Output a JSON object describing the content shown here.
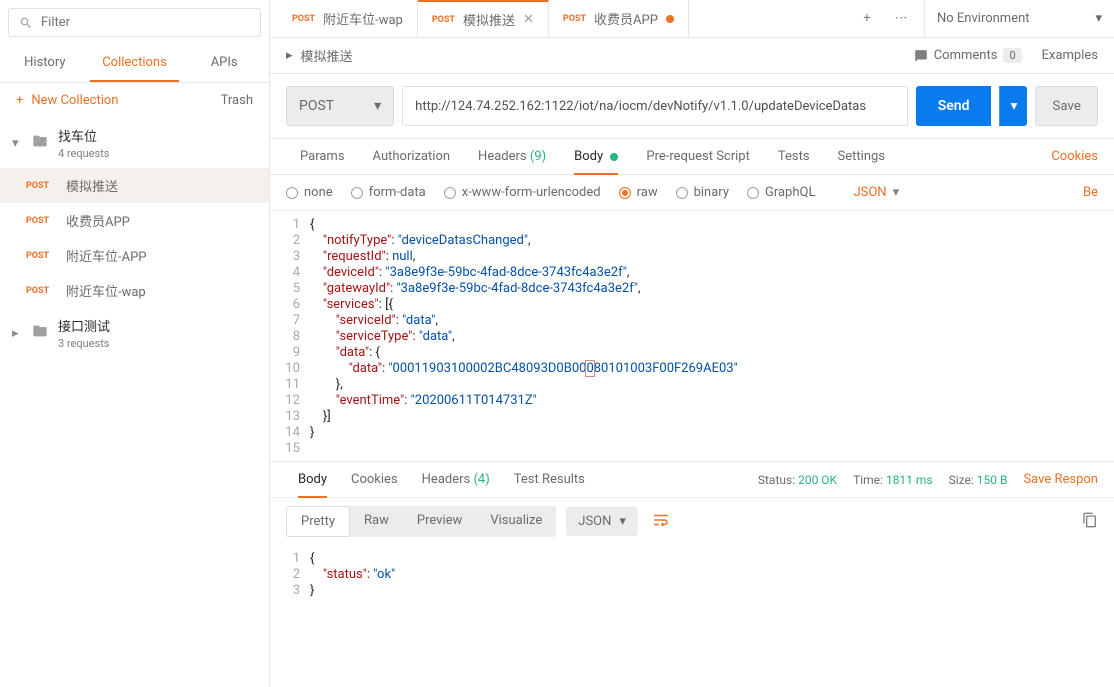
{
  "sidebar": {
    "filter_placeholder": "Filter",
    "tabs": {
      "history": "History",
      "collections": "Collections",
      "apis": "APIs"
    },
    "new_collection": "New Collection",
    "trash": "Trash",
    "folders": [
      {
        "name": "找车位",
        "sub": "4 requests",
        "expanded": true,
        "items": [
          {
            "method": "POST",
            "label": "模拟推送",
            "selected": true
          },
          {
            "method": "POST",
            "label": "收费员APP"
          },
          {
            "method": "POST",
            "label": "附近车位-APP"
          },
          {
            "method": "POST",
            "label": "附近车位-wap"
          }
        ]
      },
      {
        "name": "接口测试",
        "sub": "3 requests",
        "expanded": false
      }
    ]
  },
  "tabs": [
    {
      "method": "POST",
      "label": "附近车位-wap"
    },
    {
      "method": "POST",
      "label": "模拟推送",
      "active": true,
      "closable": true
    },
    {
      "method": "POST",
      "label": "收费员APP",
      "unsaved": true
    }
  ],
  "env": {
    "label": "No Environment"
  },
  "breadcrumb": {
    "title": "模拟推送"
  },
  "comments": {
    "label": "Comments",
    "count": "0"
  },
  "examples": "Examples",
  "request": {
    "method": "POST",
    "url": "http://124.74.252.162:1122/iot/na/iocm/devNotify/v1.1.0/updateDeviceDatas",
    "send": "Send",
    "save": "Save"
  },
  "req_tabs": {
    "params": "Params",
    "authorization": "Authorization",
    "headers": "Headers",
    "headers_count": "(9)",
    "body": "Body",
    "prerequest": "Pre-request Script",
    "tests": "Tests",
    "settings": "Settings",
    "cookies": "Cookies"
  },
  "body_types": {
    "none": "none",
    "form": "form-data",
    "url": "x-www-form-urlencoded",
    "raw": "raw",
    "binary": "binary",
    "graphql": "GraphQL",
    "lang": "JSON",
    "beautify": "Be"
  },
  "body_code": [
    {
      "n": "1",
      "indent": 0,
      "segs": [
        {
          "c": "tok-p",
          "t": "{"
        }
      ]
    },
    {
      "n": "2",
      "indent": 1,
      "segs": [
        {
          "c": "tok-k",
          "t": "\"notifyType\""
        },
        {
          "c": "tok-p",
          "t": ": "
        },
        {
          "c": "tok-s",
          "t": "\"deviceDatasChanged\""
        },
        {
          "c": "tok-p",
          "t": ","
        }
      ]
    },
    {
      "n": "3",
      "indent": 1,
      "segs": [
        {
          "c": "tok-k",
          "t": "\"requestId\""
        },
        {
          "c": "tok-p",
          "t": ": "
        },
        {
          "c": "tok-kw",
          "t": "null"
        },
        {
          "c": "tok-p",
          "t": ","
        }
      ]
    },
    {
      "n": "4",
      "indent": 1,
      "segs": [
        {
          "c": "tok-k",
          "t": "\"deviceId\""
        },
        {
          "c": "tok-p",
          "t": ": "
        },
        {
          "c": "tok-s",
          "t": "\"3a8e9f3e-59bc-4fad-8dce-3743fc4a3e2f\""
        },
        {
          "c": "tok-p",
          "t": ","
        }
      ]
    },
    {
      "n": "5",
      "indent": 1,
      "segs": [
        {
          "c": "tok-k",
          "t": "\"gatewayId\""
        },
        {
          "c": "tok-p",
          "t": ": "
        },
        {
          "c": "tok-s",
          "t": "\"3a8e9f3e-59bc-4fad-8dce-3743fc4a3e2f\""
        },
        {
          "c": "tok-p",
          "t": ","
        }
      ]
    },
    {
      "n": "6",
      "indent": 1,
      "segs": [
        {
          "c": "tok-k",
          "t": "\"services\""
        },
        {
          "c": "tok-p",
          "t": ": [{"
        }
      ]
    },
    {
      "n": "7",
      "indent": 2,
      "segs": [
        {
          "c": "tok-k",
          "t": "\"serviceId\""
        },
        {
          "c": "tok-p",
          "t": ": "
        },
        {
          "c": "tok-s",
          "t": "\"data\""
        },
        {
          "c": "tok-p",
          "t": ","
        }
      ]
    },
    {
      "n": "8",
      "indent": 2,
      "segs": [
        {
          "c": "tok-k",
          "t": "\"serviceType\""
        },
        {
          "c": "tok-p",
          "t": ": "
        },
        {
          "c": "tok-s",
          "t": "\"data\""
        },
        {
          "c": "tok-p",
          "t": ","
        }
      ]
    },
    {
      "n": "9",
      "indent": 2,
      "segs": [
        {
          "c": "tok-k",
          "t": "\"data\""
        },
        {
          "c": "tok-p",
          "t": ": {"
        }
      ]
    },
    {
      "n": "10",
      "indent": 3,
      "segs": [
        {
          "c": "tok-k",
          "t": "\"data\""
        },
        {
          "c": "tok-p",
          "t": ": "
        },
        {
          "c": "tok-s",
          "t": "\"00011903100002BC48093D0B00"
        },
        {
          "c": "tok-s caret-mark",
          "t": "0"
        },
        {
          "c": "tok-s",
          "t": "80101003F00F269AE03\""
        }
      ]
    },
    {
      "n": "11",
      "indent": 2,
      "segs": [
        {
          "c": "tok-p",
          "t": "},"
        }
      ]
    },
    {
      "n": "12",
      "indent": 2,
      "segs": [
        {
          "c": "tok-k",
          "t": "\"eventTime\""
        },
        {
          "c": "tok-p",
          "t": ": "
        },
        {
          "c": "tok-s",
          "t": "\"20200611T014731Z\""
        }
      ]
    },
    {
      "n": "13",
      "indent": 1,
      "segs": [
        {
          "c": "tok-p",
          "t": "}]"
        }
      ]
    },
    {
      "n": "14",
      "indent": 0,
      "segs": [
        {
          "c": "tok-p",
          "t": "}"
        }
      ]
    },
    {
      "n": "15",
      "indent": 0,
      "segs": []
    }
  ],
  "resp_tabs": {
    "body": "Body",
    "cookies": "Cookies",
    "headers": "Headers",
    "headers_count": "(4)",
    "testresults": "Test Results"
  },
  "resp_meta": {
    "status_l": "Status:",
    "status_v": "200 OK",
    "time_l": "Time:",
    "time_v": "1811 ms",
    "size_l": "Size:",
    "size_v": "150 B",
    "save": "Save Respon"
  },
  "resp_toolbar": {
    "pretty": "Pretty",
    "raw": "Raw",
    "preview": "Preview",
    "visualize": "Visualize",
    "lang": "JSON"
  },
  "resp_code": [
    {
      "n": "1",
      "indent": 0,
      "segs": [
        {
          "c": "tok-p",
          "t": "{"
        }
      ]
    },
    {
      "n": "2",
      "indent": 1,
      "segs": [
        {
          "c": "tok-k",
          "t": "\"status\""
        },
        {
          "c": "tok-p",
          "t": ": "
        },
        {
          "c": "tok-s",
          "t": "\"ok\""
        }
      ]
    },
    {
      "n": "3",
      "indent": 0,
      "segs": [
        {
          "c": "tok-p",
          "t": "}"
        }
      ]
    }
  ]
}
